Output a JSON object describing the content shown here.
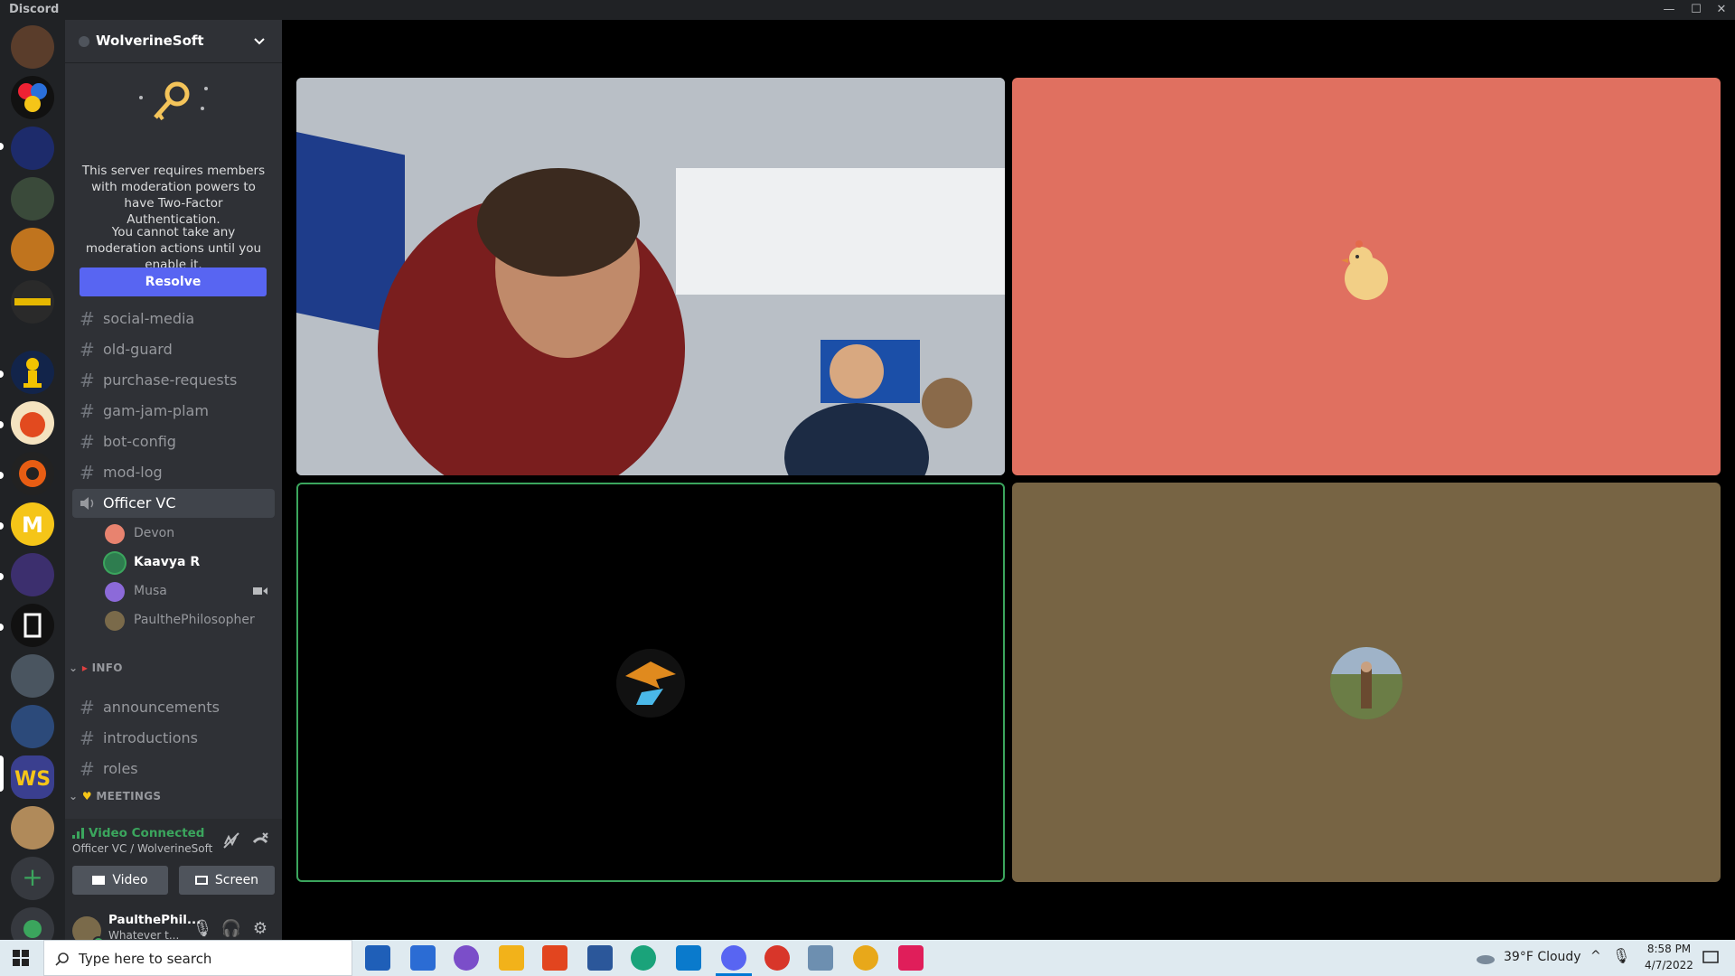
{
  "app": {
    "title": "Discord"
  },
  "window_controls": {
    "minimize": "—",
    "maximize": "☐",
    "close": "✕"
  },
  "server": {
    "name": "WolverineSoft"
  },
  "mfa": {
    "message": "This server requires members with moderation powers to have Two-Factor Authentication.",
    "sub_message": "You cannot take any moderation actions until you enable it.",
    "button": "Resolve"
  },
  "channels": [
    {
      "name": "social-media"
    },
    {
      "name": "old-guard"
    },
    {
      "name": "purchase-requests"
    },
    {
      "name": "gam-jam-plam"
    },
    {
      "name": "bot-config"
    },
    {
      "name": "mod-log"
    }
  ],
  "voice_channel": {
    "name": "Officer VC",
    "users": [
      {
        "name": "Devon",
        "color": "#e8836f"
      },
      {
        "name": "Kaavya R",
        "color": "#2e7d4f"
      },
      {
        "name": "Musa",
        "color": "#8c6ad9"
      },
      {
        "name": "PaultheP hilosopher",
        "color": "#7a6a4a"
      }
    ]
  },
  "voice_users_fixed": [
    "Devon",
    "Kaavya R",
    "Musa",
    "PaulthePhilosopher"
  ],
  "info_category": {
    "name": "INFO",
    "channels": [
      {
        "name": "announcements"
      },
      {
        "name": "introductions"
      },
      {
        "name": "roles"
      }
    ]
  },
  "meetings_category": {
    "name": "MEETINGS"
  },
  "voice_panel": {
    "status": "Video Connected",
    "location": "Officer VC / WolverineSoft",
    "video_label": "Video",
    "screen_label": "Screen"
  },
  "user": {
    "name": "PaulthePhil...",
    "status": "Whatever t..."
  },
  "colors": {
    "tile_red": "#e07060",
    "tile_black": "#000000",
    "tile_olive": "#776444",
    "speaking_border": "#3ba55d",
    "accent": "#5865f2"
  },
  "taskbar": {
    "search_placeholder": "Type here to search",
    "weather": "39°F  Cloudy",
    "time": "8:58 PM",
    "date": "4/7/2022"
  }
}
